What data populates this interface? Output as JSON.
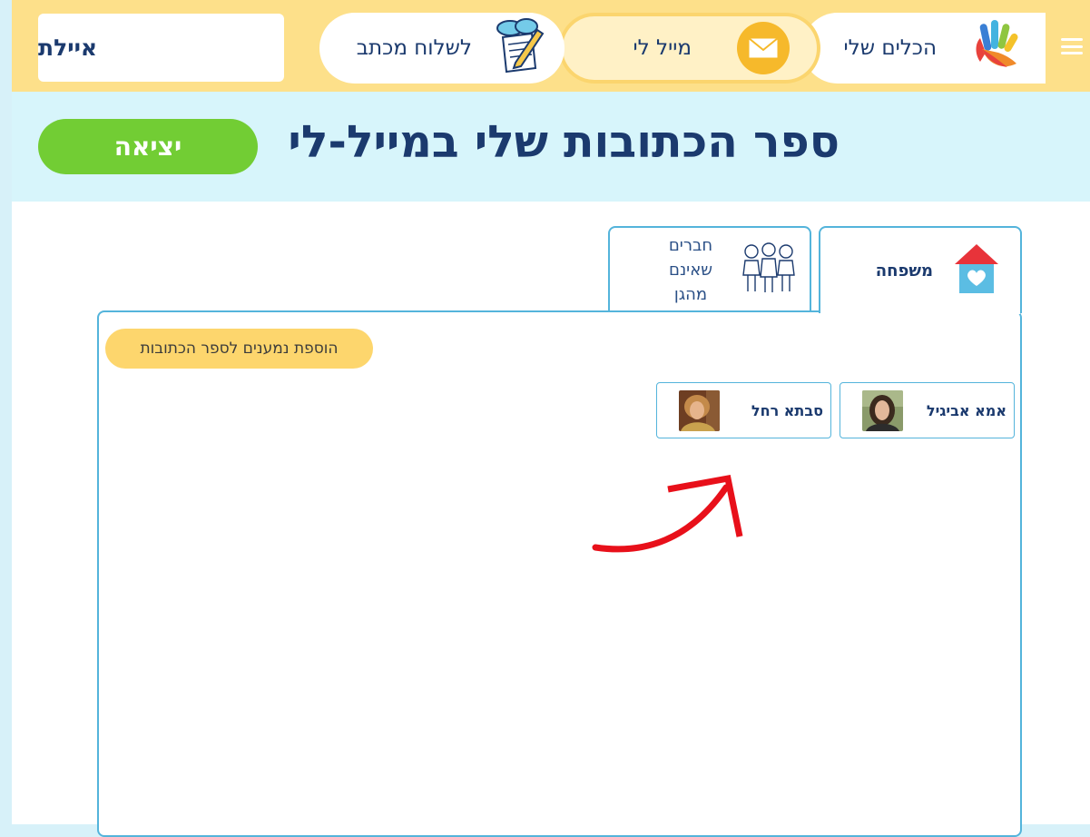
{
  "user": {
    "name": "איילת"
  },
  "nav": {
    "write_letter": "לשלוח מכתב",
    "my_mail": "מייל לי",
    "my_tools": "הכלים שלי"
  },
  "header": {
    "title": "ספר הכתובות שלי במייל-לי",
    "exit_label": "יציאה"
  },
  "tabs": {
    "family": "משפחה",
    "friends_line1": "חברים שאינם",
    "friends_line2": "מהגן"
  },
  "panel": {
    "add_button": "הוספת נמענים לספר הכתובות",
    "contacts": [
      {
        "name": "אמא אביגיל"
      },
      {
        "name": "סבתא רחל"
      }
    ]
  },
  "colors": {
    "topbar": "#fde08a",
    "header_bg": "#d7f5fb",
    "title": "#1b3a6e",
    "exit_button": "#72cd34",
    "add_button": "#fdd66d",
    "border": "#54b4db",
    "annotation_arrow": "#e8101a"
  }
}
